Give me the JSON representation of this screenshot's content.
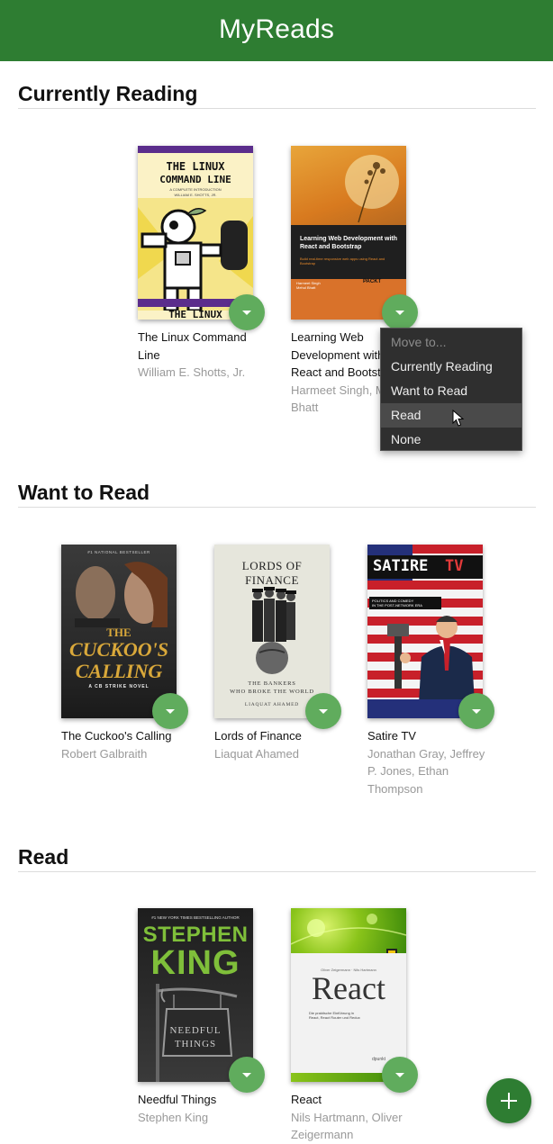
{
  "app": {
    "title": "MyReads"
  },
  "shelves": [
    {
      "title": "Currently Reading",
      "books": [
        {
          "title": "The Linux Command Line",
          "authors": "William E. Shotts, Jr.",
          "cover_text": [
            "THE LINUX",
            "COMMAND LINE",
            "A COMPLETE INTRODUCTION",
            "WILLIAM E. SHOTTS, JR.",
            "THE LINUX"
          ]
        },
        {
          "title": "Learning Web Development with React and Bootstrap",
          "authors": "Harmeet Singh, Mehul Bhatt",
          "cover_text": [
            "Learning Web Development with React and Bootstrap",
            "Build real-time responsive web apps using React and Bootstrap",
            "Harmeet Singh",
            "Mehul Bhatt",
            "PACKT"
          ]
        }
      ]
    },
    {
      "title": "Want to Read",
      "books": [
        {
          "title": "The Cuckoo's Calling",
          "authors": "Robert Galbraith",
          "cover_text": [
            "#1 NATIONAL BESTSELLER",
            "THE",
            "CUCKOO'S",
            "CALLING",
            "A CB STRIKE NOVEL"
          ]
        },
        {
          "title": "Lords of Finance",
          "authors": "Liaquat Ahamed",
          "cover_text": [
            "LORDS OF FINANCE",
            "THE BANKERS",
            "WHO BROKE THE WORLD",
            "LIAQUAT AHAMED"
          ]
        },
        {
          "title": "Satire TV",
          "authors": "Jonathan Gray, Jeffrey P. Jones, Ethan Thompson",
          "cover_text": [
            "SATIRE",
            "TV",
            "POLITICS AND COMEDY",
            "IN THE POST-NETWORK ERA"
          ]
        }
      ]
    },
    {
      "title": "Read",
      "books": [
        {
          "title": "Needful Things",
          "authors": "Stephen King",
          "cover_text": [
            "#1 NEW YORK TIMES BESTSELLING AUTHOR",
            "STEPHEN",
            "KING",
            "NEEDFUL",
            "THINGS"
          ]
        },
        {
          "title": "React",
          "authors": "Nils Hartmann, Oliver Zeigermann",
          "cover_text": [
            "Oliver Zeigermann · Nils Hartmann",
            "React",
            "Die praktische Einführung in",
            "React, React Router und Redux",
            "dpunkt"
          ]
        }
      ]
    }
  ],
  "shelf_menu": {
    "header": "Move to...",
    "options": [
      "Currently Reading",
      "Want to Read",
      "Read",
      "None"
    ],
    "highlighted": "Read"
  },
  "colors": {
    "header": "#2e7d32",
    "changer": "#60ac5d",
    "menu_bg": "#2f2f2f"
  },
  "icons": {
    "shelf_changer": "caret-down-icon",
    "add": "plus-icon",
    "pointer": "mouse-pointer-icon"
  }
}
